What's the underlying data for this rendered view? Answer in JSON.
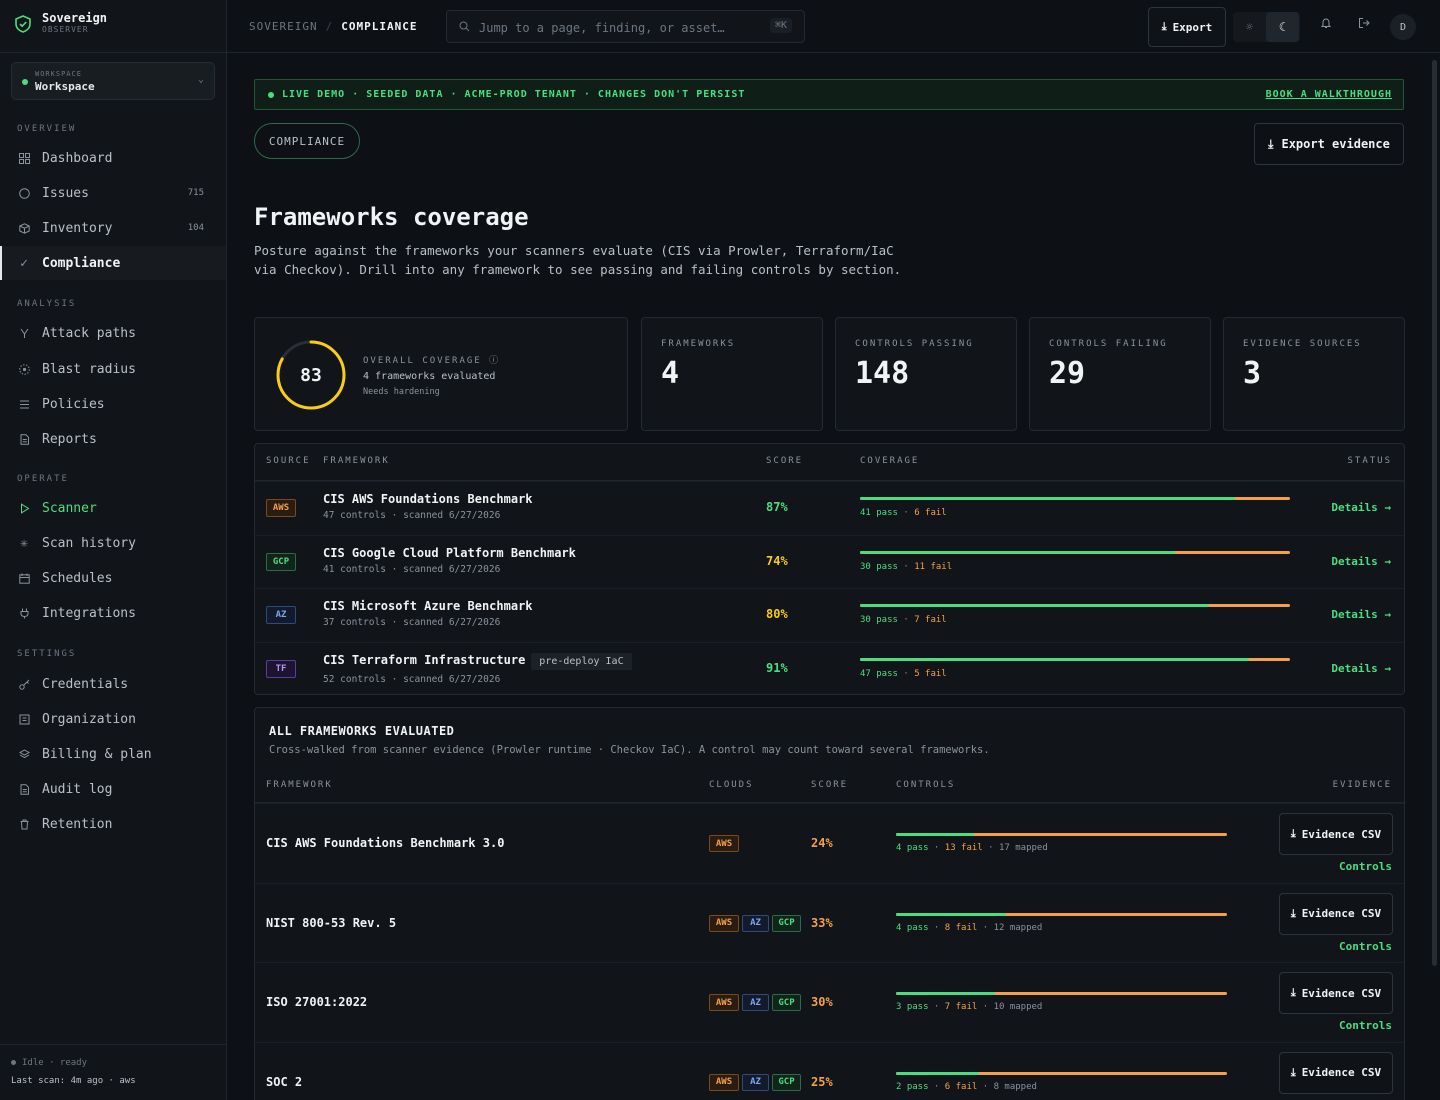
{
  "brand": {
    "name": "Sovereign",
    "sub": "OBSERVER"
  },
  "workspace": {
    "label": "WORKSPACE",
    "name": "Workspace"
  },
  "nav": {
    "overview": "OVERVIEW",
    "analysis": "ANALYSIS",
    "operate": "OPERATE",
    "settings": "SETTINGS",
    "items": {
      "dashboard": "Dashboard",
      "issues": "Issues",
      "issues_count": "715",
      "inventory": "Inventory",
      "inventory_count": "104",
      "compliance": "Compliance",
      "attack_paths": "Attack paths",
      "blast_radius": "Blast radius",
      "policies": "Policies",
      "reports": "Reports",
      "scanner": "Scanner",
      "scan_history": "Scan history",
      "schedules": "Schedules",
      "integrations": "Integrations",
      "credentials": "Credentials",
      "organization": "Organization",
      "billing": "Billing & plan",
      "audit_log": "Audit log",
      "retention": "Retention"
    }
  },
  "sidebar_footer": {
    "status": "Idle · ready",
    "last_scan": "Last scan: 4m ago · aws"
  },
  "topbar": {
    "crumb_root": "SOVEREIGN",
    "crumb_sep": "/",
    "crumb_current": "COMPLIANCE",
    "search_placeholder": "Jump to a page, finding, or asset…",
    "search_kbd": "⌘K",
    "export_label": "Export",
    "avatar_initial": "D"
  },
  "banner": {
    "text": "LIVE DEMO · SEEDED DATA · ACME-PROD TENANT · CHANGES DON'T PERSIST",
    "link": "BOOK A WALKTHROUGH"
  },
  "page": {
    "pill": "COMPLIANCE",
    "export_evidence": "Export evidence",
    "title": "Frameworks coverage",
    "description": "Posture against the frameworks your scanners evaluate (CIS via Prowler, Terraform/IaC via Checkov). Drill into any framework to see passing and failing controls by section."
  },
  "stats": {
    "overall": {
      "score": "83",
      "score_value": 83,
      "label": "OVERALL COVERAGE",
      "sub": "4 frameworks evaluated",
      "note": "Needs hardening"
    },
    "frameworks": {
      "label": "FRAMEWORKS",
      "value": "4"
    },
    "passing": {
      "label": "CONTROLS PASSING",
      "value": "148"
    },
    "failing": {
      "label": "CONTROLS FAILING",
      "value": "29"
    },
    "sources": {
      "label": "EVIDENCE SOURCES",
      "value": "3"
    }
  },
  "frameworks_table": {
    "headers": {
      "source": "SOURCE",
      "framework": "FRAMEWORK",
      "score": "SCORE",
      "coverage": "COVERAGE",
      "status": "STATUS"
    },
    "details_label": "Details →",
    "rows": [
      {
        "tag": "AWS",
        "tag_kind": "aws",
        "name": "CIS AWS Foundations Benchmark",
        "chip": "",
        "meta": "47 controls · scanned 6/27/2026",
        "score": "87%",
        "score_color": "#4ade80",
        "pass": 41,
        "fail": 6,
        "pass_label": "41 pass",
        "fail_label": "6 fail"
      },
      {
        "tag": "GCP",
        "tag_kind": "gcp",
        "name": "CIS Google Cloud Platform Benchmark",
        "chip": "",
        "meta": "41 controls · scanned 6/27/2026",
        "score": "74%",
        "score_color": "#facc15",
        "pass": 30,
        "fail": 11,
        "pass_label": "30 pass",
        "fail_label": "11 fail"
      },
      {
        "tag": "AZ",
        "tag_kind": "az",
        "name": "CIS Microsoft Azure Benchmark",
        "chip": "",
        "meta": "37 controls · scanned 6/27/2026",
        "score": "80%",
        "score_color": "#facc15",
        "pass": 30,
        "fail": 7,
        "pass_label": "30 pass",
        "fail_label": "7 fail"
      },
      {
        "tag": "TF",
        "tag_kind": "tf",
        "name": "CIS Terraform Infrastructure",
        "chip": "pre-deploy IaC",
        "meta": "52 controls · scanned 6/27/2026",
        "score": "91%",
        "score_color": "#4ade80",
        "pass": 47,
        "fail": 5,
        "pass_label": "47 pass",
        "fail_label": "5 fail"
      }
    ]
  },
  "all_frameworks": {
    "title": "ALL FRAMEWORKS EVALUATED",
    "subtitle": "Cross-walked from scanner evidence (Prowler runtime · Checkov IaC). A control may count toward several frameworks.",
    "headers": {
      "framework": "FRAMEWORK",
      "clouds": "CLOUDS",
      "score": "SCORE",
      "controls": "CONTROLS",
      "evidence": "EVIDENCE"
    },
    "evidence_btn": "Evidence CSV",
    "controls_link": "Controls",
    "rows": [
      {
        "name": "CIS AWS Foundations Benchmark 3.0",
        "clouds": [
          "AWS"
        ],
        "score": "24%",
        "pass": 4,
        "fail": 13,
        "pass_label": "4 pass",
        "fail_label": "13 fail",
        "mapped_label": "17 mapped"
      },
      {
        "name": "NIST 800-53 Rev. 5",
        "clouds": [
          "AWS",
          "AZ",
          "GCP"
        ],
        "score": "33%",
        "pass": 4,
        "fail": 8,
        "pass_label": "4 pass",
        "fail_label": "8 fail",
        "mapped_label": "12 mapped"
      },
      {
        "name": "ISO 27001:2022",
        "clouds": [
          "AWS",
          "AZ",
          "GCP"
        ],
        "score": "30%",
        "pass": 3,
        "fail": 7,
        "pass_label": "3 pass",
        "fail_label": "7 fail",
        "mapped_label": "10 mapped"
      },
      {
        "name": "SOC 2",
        "clouds": [
          "AWS",
          "AZ",
          "GCP"
        ],
        "score": "25%",
        "pass": 2,
        "fail": 6,
        "pass_label": "2 pass",
        "fail_label": "6 fail",
        "mapped_label": "8 mapped"
      }
    ]
  },
  "colors": {
    "accent": "#4ade80",
    "warn": "#f4a14a",
    "ring": "#facc15",
    "bg": "#0d1014"
  }
}
